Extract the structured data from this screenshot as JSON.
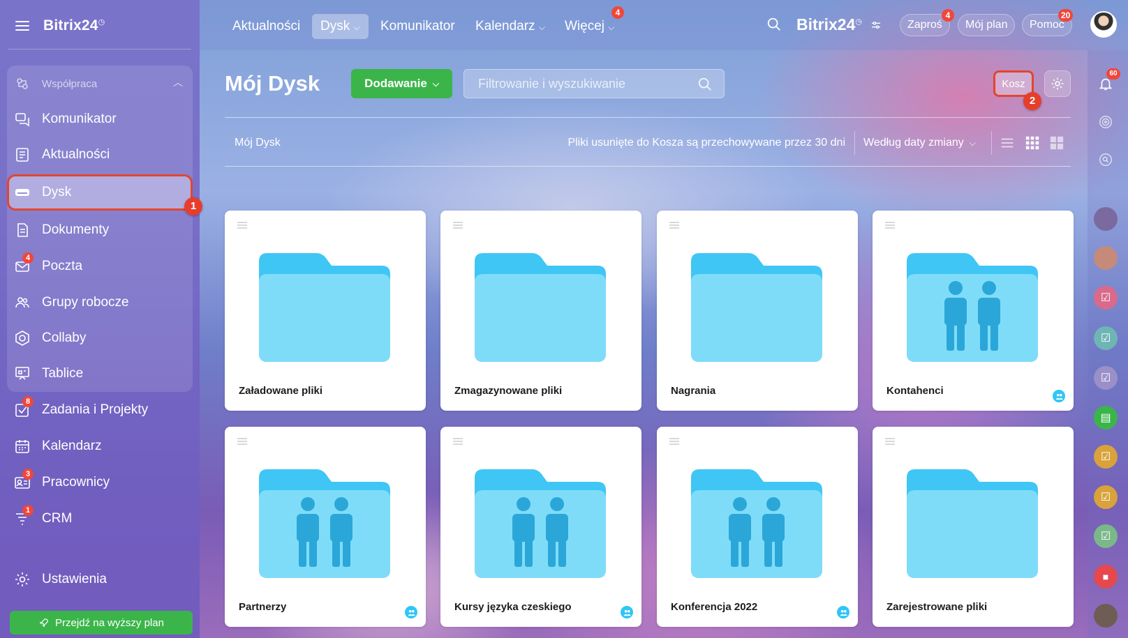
{
  "sidebar": {
    "brand": "Bitrix24",
    "group_title": "Współpraca",
    "items": [
      {
        "label": "Komunikator",
        "badge": ""
      },
      {
        "label": "Aktualności",
        "badge": ""
      },
      {
        "label": "Dysk",
        "badge": ""
      },
      {
        "label": "Dokumenty",
        "badge": ""
      },
      {
        "label": "Poczta",
        "badge": "4"
      },
      {
        "label": "Grupy robocze",
        "badge": ""
      },
      {
        "label": "Collaby",
        "badge": ""
      },
      {
        "label": "Tablice",
        "badge": ""
      },
      {
        "label": "Zadania i Projekty",
        "badge": "8"
      },
      {
        "label": "Kalendarz",
        "badge": ""
      },
      {
        "label": "Pracownicy",
        "badge": "3"
      },
      {
        "label": "CRM",
        "badge": "1"
      }
    ],
    "settings_label": "Ustawienia",
    "upgrade_label": "Przejdź na wyższy plan"
  },
  "topbar": {
    "links": [
      "Aktualności",
      "Dysk",
      "Komunikator",
      "Kalendarz",
      "Więcej"
    ],
    "more_badge": "4",
    "brand": "Bitrix24",
    "invite_label": "Zaproś",
    "invite_badge": "4",
    "plan_label": "Mój plan",
    "help_label": "Pomoc",
    "help_badge": "20"
  },
  "content": {
    "title": "Mój Dysk",
    "add_button": "Dodawanie",
    "search_placeholder": "Filtrowanie i wyszukiwanie",
    "trash_button": "Kosz",
    "breadcrumb": "Mój Dysk",
    "retention_note": "Pliki usunięte do Kosza są przechowywane przez 30 dni",
    "sort_label": "Według daty zmiany",
    "folders": [
      {
        "name": "Załadowane pliki",
        "shared": false
      },
      {
        "name": "Zmagazynowane pliki",
        "shared": false
      },
      {
        "name": "Nagrania",
        "shared": false
      },
      {
        "name": "Kontahenci",
        "shared": true
      },
      {
        "name": "Partnerzy",
        "shared": true
      },
      {
        "name": "Kursy języka czeskiego",
        "shared": true
      },
      {
        "name": "Konferencja 2022",
        "shared": true
      },
      {
        "name": "Zarejestrowane pliki",
        "shared": false
      }
    ]
  },
  "callouts": {
    "first": "1",
    "second": "2"
  },
  "rail": {
    "notifications_badge": "60"
  },
  "colors": {
    "accent_green": "#3bb54a",
    "folder_blue": "#7fdcf8",
    "folder_tab": "#3fc6f5",
    "highlight_red": "#e0462f"
  },
  "icons": [
    "menu-icon",
    "search-icon",
    "gear-icon",
    "bell-icon",
    "folder-icon",
    "shared-folder-icon",
    "rocket-icon"
  ]
}
